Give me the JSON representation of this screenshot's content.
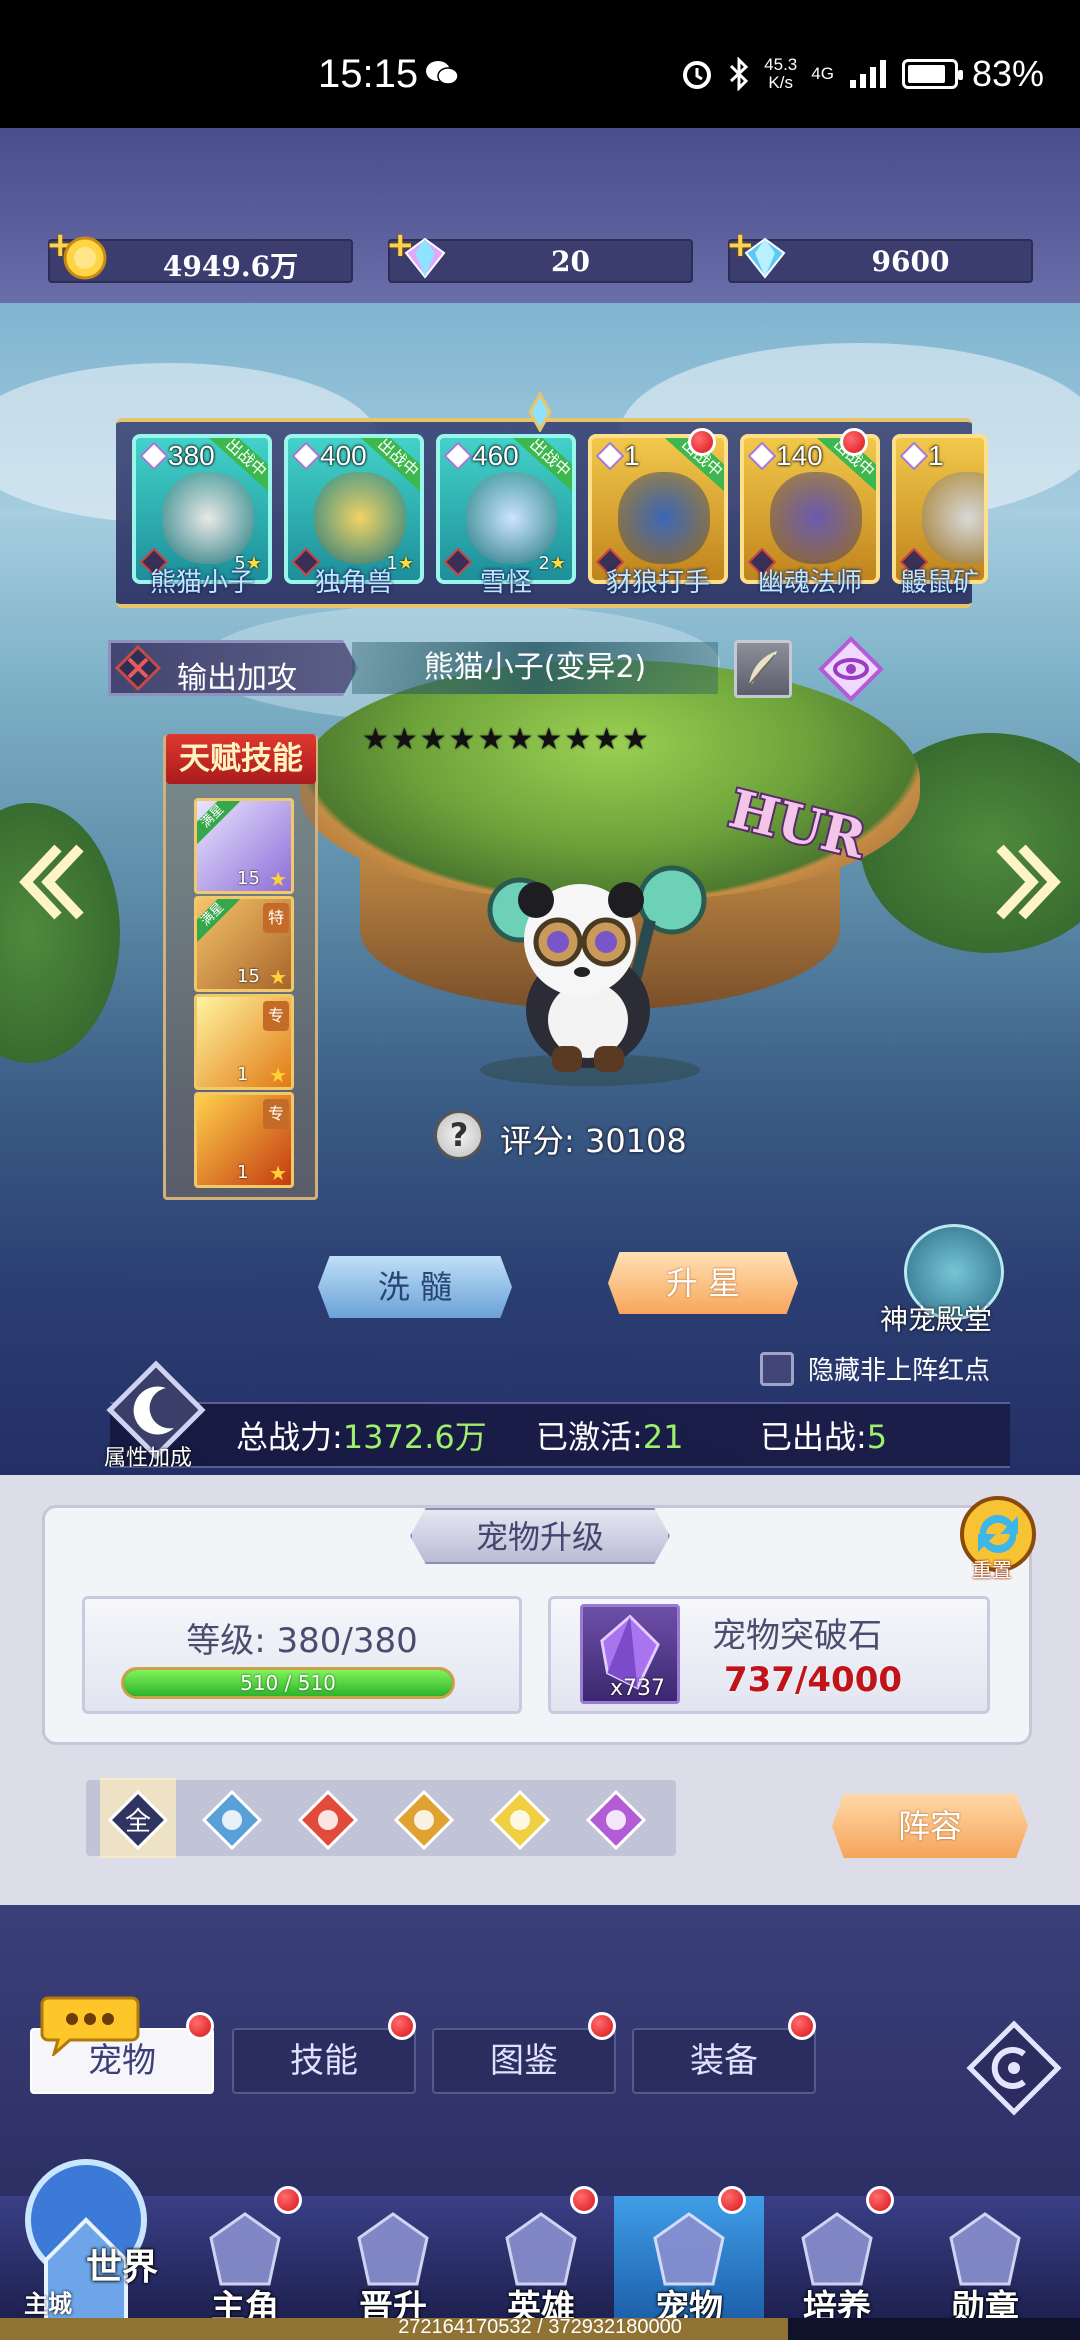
{
  "status_bar": {
    "time": "15:15",
    "net_speed": "45.3",
    "net_unit": "K/s",
    "net_type": "4G",
    "battery": "83%",
    "battery_level": 0.83
  },
  "currencies": [
    {
      "icon": "gold-coin-icon",
      "value": "4949.6万"
    },
    {
      "icon": "rainbow-diamond-icon",
      "value": "20"
    },
    {
      "icon": "blue-diamond-icon",
      "value": "9600"
    }
  ],
  "roster": [
    {
      "level": "380",
      "name": "熊猫小子",
      "deployed": "出战中",
      "frame": "cyan",
      "stars": "5",
      "red_dot": false
    },
    {
      "level": "400",
      "name": "独角兽",
      "deployed": "出战中",
      "frame": "cyan",
      "stars": "1",
      "red_dot": false
    },
    {
      "level": "460",
      "name": "雪怪",
      "deployed": "出战中",
      "frame": "cyan",
      "stars": "2",
      "red_dot": false
    },
    {
      "level": "1",
      "name": "豺狼打手",
      "deployed": "出战中",
      "frame": "gold",
      "stars": "",
      "red_dot": true
    },
    {
      "level": "140",
      "name": "幽魂法师",
      "deployed": "出战中",
      "frame": "gold",
      "stars": "",
      "red_dot": true
    },
    {
      "level": "1",
      "name": "鼹鼠矿",
      "deployed": "",
      "frame": "gold",
      "stars": "",
      "red_dot": false
    }
  ],
  "pet": {
    "type_label": "输出加攻",
    "name": "熊猫小子(变异2)",
    "stars": "★★★★★★★★★★",
    "rarity": "HUR",
    "score_label": "评分: 30108"
  },
  "talent": {
    "title": "天赋技能",
    "skills": [
      {
        "level": "15",
        "full": "满星",
        "tag": ""
      },
      {
        "level": "15",
        "full": "满星",
        "tag": "特"
      },
      {
        "level": "1",
        "full": "",
        "tag": "专"
      },
      {
        "level": "1",
        "full": "",
        "tag": "专"
      }
    ]
  },
  "actions": {
    "wash": "洗 髓",
    "star_up": "升 星",
    "temple": "神宠殿堂",
    "hide_red": "隐藏非上阵红点",
    "attr_bonus": "属性加成"
  },
  "stats": {
    "power_label": "总战力:",
    "power": "1372.6万",
    "activated_label": "已激活:",
    "activated": "21",
    "deployed_label": "已出战:",
    "deployed": "5"
  },
  "upgrade": {
    "title": "宠物升级",
    "reset": "重置",
    "level_label": "等级:  380/380",
    "exp": "510 / 510",
    "exp_fraction": 1.0,
    "stone_name": "宠物突破石",
    "stone_count": "x737",
    "stone_progress": "737/4000"
  },
  "filters": [
    "全",
    "water",
    "fire",
    "earth",
    "light",
    "dark"
  ],
  "lineup": "阵容",
  "tabs": [
    "宠物",
    "技能",
    "图鉴",
    "装备"
  ],
  "nav": {
    "world": "世界",
    "city": "主城",
    "items": [
      "主角",
      "晋升",
      "英雄",
      "宠物",
      "培养",
      "勋章"
    ],
    "active": "宠物"
  },
  "footer_text": "272164170532 / 372932180000",
  "footer_fraction": 0.73,
  "colors": {
    "accent_gold": "#e8c46a",
    "power_green": "#9ef06a",
    "red": "#c0141a"
  }
}
